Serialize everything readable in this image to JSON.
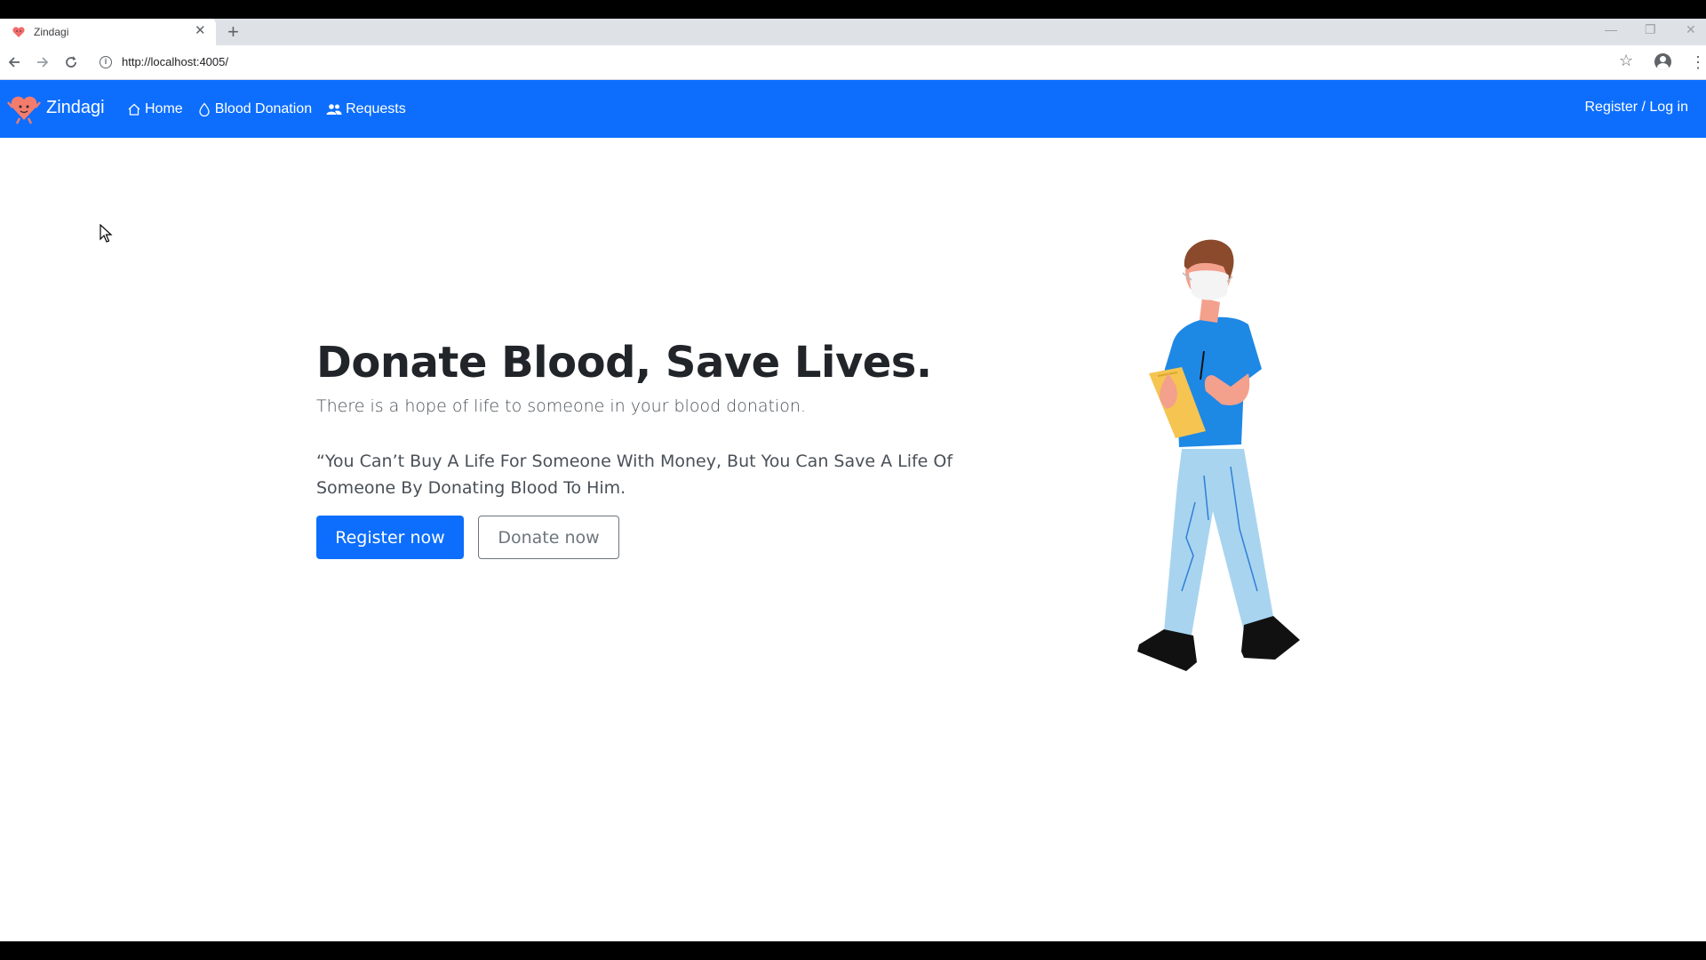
{
  "browser": {
    "tab_title": "Zindagi",
    "tab_close": "✕",
    "new_tab": "+",
    "url": "http://localhost:4005/",
    "window_controls": {
      "minimize": "—",
      "restore": "❐",
      "close": "✕"
    }
  },
  "navbar": {
    "brand": "Zindagi",
    "links": [
      {
        "label": "Home",
        "icon": "home-icon"
      },
      {
        "label": "Blood Donation",
        "icon": "droplet-icon"
      },
      {
        "label": "Requests",
        "icon": "people-icon"
      }
    ],
    "auth_link": "Register / Log in",
    "color": "#0d6efd"
  },
  "hero": {
    "title": "Donate Blood, Save Lives.",
    "subtitle": "There is a hope of life to someone in your blood donation.",
    "quote": "“You Can’t Buy A Life For Someone With Money, But You Can Save A Life Of Someone By Donating Blood To Him.",
    "primary_button": "Register now",
    "secondary_button": "Donate now"
  }
}
